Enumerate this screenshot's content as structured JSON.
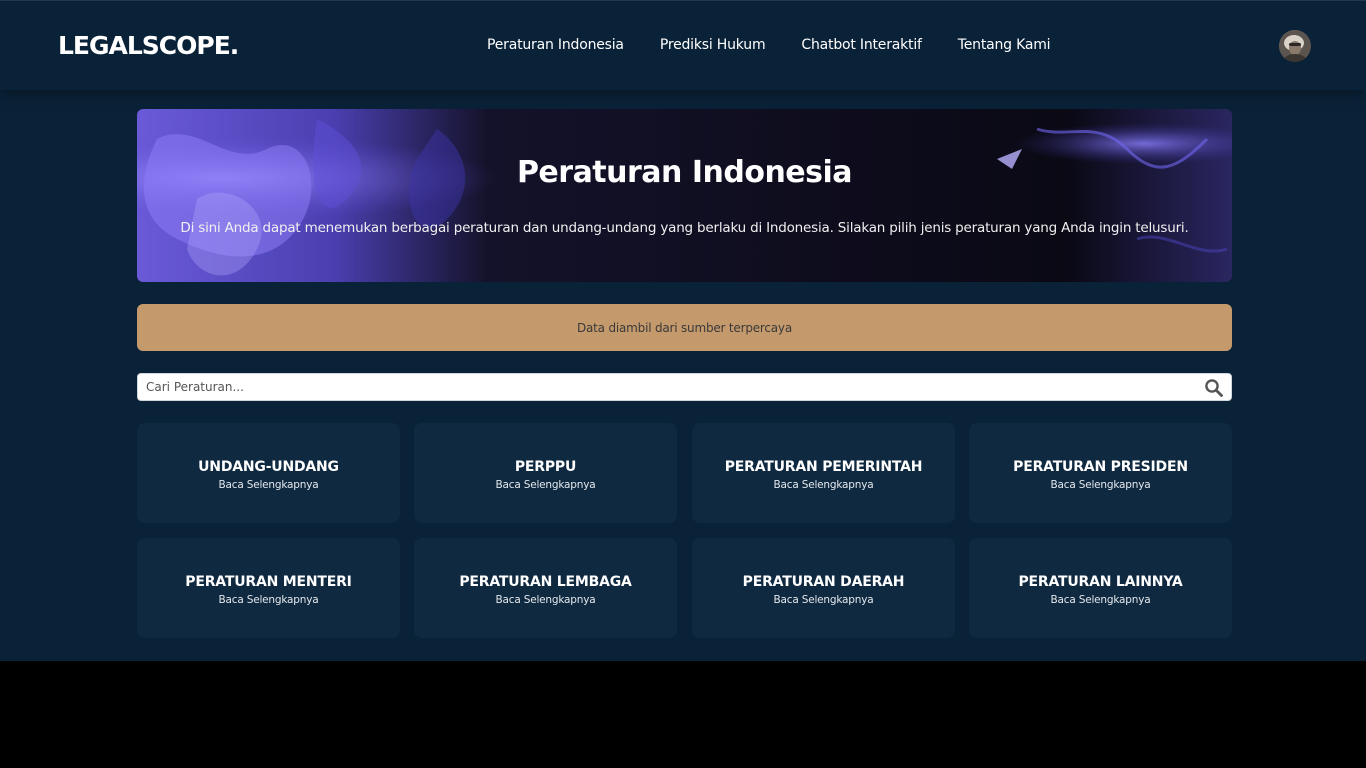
{
  "navbar": {
    "logo": "LEGALSCOPE.",
    "links": [
      {
        "label": "Peraturan Indonesia"
      },
      {
        "label": "Prediksi Hukum"
      },
      {
        "label": "Chatbot Interaktif"
      },
      {
        "label": "Tentang Kami"
      }
    ]
  },
  "hero": {
    "title": "Peraturan Indonesia",
    "description": "Di sini Anda dapat menemukan berbagai peraturan dan undang-undang yang berlaku di Indonesia. Silakan pilih jenis peraturan yang Anda ingin telusuri."
  },
  "info": {
    "text": "Data diambil dari sumber terpercaya"
  },
  "search": {
    "placeholder": "Cari Peraturan..."
  },
  "cards": [
    {
      "title": "UNDANG-UNDANG",
      "link": "Baca Selengkapnya"
    },
    {
      "title": "PERPPU",
      "link": "Baca Selengkapnya"
    },
    {
      "title": "PERATURAN PEMERINTAH",
      "link": "Baca Selengkapnya"
    },
    {
      "title": "PERATURAN PRESIDEN",
      "link": "Baca Selengkapnya"
    },
    {
      "title": "PERATURAN MENTERI",
      "link": "Baca Selengkapnya"
    },
    {
      "title": "PERATURAN LEMBAGA",
      "link": "Baca Selengkapnya"
    },
    {
      "title": "PERATURAN DAERAH",
      "link": "Baca Selengkapnya"
    },
    {
      "title": "PERATURAN LAINNYA",
      "link": "Baca Selengkapnya"
    }
  ],
  "colors": {
    "background": "#0a2238",
    "card": "#0f2941",
    "info_bar": "#c4996b",
    "hero_accent": "#6b5ce0"
  },
  "icons": [
    "search-icon",
    "avatar-image"
  ]
}
